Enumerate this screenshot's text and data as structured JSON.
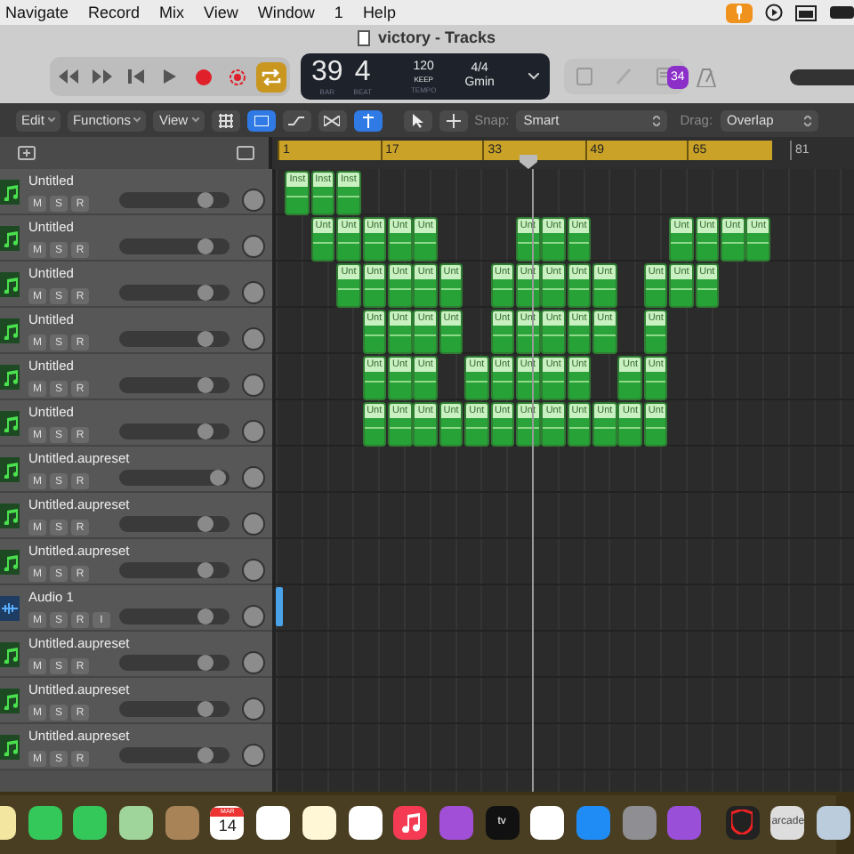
{
  "menu_bar": {
    "items": [
      "Navigate",
      "Record",
      "Mix",
      "View",
      "Window",
      "1",
      "Help"
    ]
  },
  "window": {
    "title": "victory - Tracks"
  },
  "transport": [
    {
      "kind": "rewind"
    },
    {
      "kind": "forward"
    },
    {
      "kind": "to-start"
    },
    {
      "kind": "play"
    },
    {
      "kind": "record"
    },
    {
      "kind": "capture"
    },
    {
      "kind": "cycle",
      "on": true
    }
  ],
  "lcd": {
    "bar": "39",
    "beat": "4",
    "bar_label": "BAR",
    "beat_label": "BEAT",
    "tempo": "120",
    "tempo_mode": "KEEP",
    "tempo_label": "TEMPO",
    "signature": "4/4",
    "key": "Gmin"
  },
  "badge": "34",
  "toolbar": {
    "menus": [
      "Edit",
      "Functions",
      "View"
    ],
    "snap_label": "Snap:",
    "snap_value": "Smart",
    "drag_label": "Drag:",
    "drag_value": "Overlap"
  },
  "ruler": {
    "markers": [
      "1",
      "17",
      "33",
      "49",
      "65",
      "81"
    ]
  },
  "tracks": [
    {
      "name": "Untitled",
      "kind": "instrument",
      "buttons": [
        "M",
        "S",
        "R"
      ],
      "level": 0.78,
      "lane": [
        {
          "kind": "region",
          "label": "Inst"
        },
        {
          "kind": "region",
          "label": "Inst"
        },
        {
          "kind": "region",
          "label": "Inst"
        }
      ]
    },
    {
      "name": "Untitled",
      "kind": "instrument",
      "buttons": [
        "M",
        "S",
        "R"
      ],
      "level": 0.78,
      "lane": [
        {
          "kind": "empty"
        },
        {
          "kind": "region",
          "label": "Unt"
        },
        {
          "kind": "region",
          "label": "Unt"
        },
        {
          "kind": "region",
          "label": "Unt"
        },
        {
          "kind": "region",
          "label": "Unt"
        },
        {
          "kind": "region",
          "label": "Unt"
        },
        {
          "kind": "empty"
        },
        {
          "kind": "empty"
        },
        {
          "kind": "empty"
        },
        {
          "kind": "region",
          "label": "Unt"
        },
        {
          "kind": "region",
          "label": "Unt"
        },
        {
          "kind": "region",
          "label": "Unt"
        },
        {
          "kind": "empty"
        },
        {
          "kind": "empty"
        },
        {
          "kind": "empty"
        },
        {
          "kind": "region",
          "label": "Unt"
        },
        {
          "kind": "region",
          "label": "Unt"
        },
        {
          "kind": "region",
          "label": "Unt"
        },
        {
          "kind": "region",
          "label": "Unt"
        }
      ]
    },
    {
      "name": "Untitled",
      "kind": "instrument",
      "buttons": [
        "M",
        "S",
        "R"
      ],
      "level": 0.78,
      "lane": [
        {
          "kind": "empty"
        },
        {
          "kind": "empty"
        },
        {
          "kind": "region",
          "label": "Unt"
        },
        {
          "kind": "region",
          "label": "Unt"
        },
        {
          "kind": "region",
          "label": "Unt"
        },
        {
          "kind": "region",
          "label": "Unt"
        },
        {
          "kind": "region",
          "label": "Unt"
        },
        {
          "kind": "empty"
        },
        {
          "kind": "region",
          "label": "Unt"
        },
        {
          "kind": "region",
          "label": "Unt"
        },
        {
          "kind": "region",
          "label": "Unt"
        },
        {
          "kind": "region",
          "label": "Unt"
        },
        {
          "kind": "region",
          "label": "Unt"
        },
        {
          "kind": "empty"
        },
        {
          "kind": "region",
          "label": "Unt"
        },
        {
          "kind": "region",
          "label": "Unt"
        },
        {
          "kind": "region",
          "label": "Unt"
        }
      ]
    },
    {
      "name": "Untitled",
      "kind": "instrument",
      "buttons": [
        "M",
        "S",
        "R"
      ],
      "level": 0.78,
      "lane": [
        {
          "kind": "empty"
        },
        {
          "kind": "empty"
        },
        {
          "kind": "empty"
        },
        {
          "kind": "region",
          "label": "Unt"
        },
        {
          "kind": "region",
          "label": "Unt"
        },
        {
          "kind": "region",
          "label": "Unt"
        },
        {
          "kind": "region",
          "label": "Unt"
        },
        {
          "kind": "empty"
        },
        {
          "kind": "region",
          "label": "Unt"
        },
        {
          "kind": "region",
          "label": "Unt"
        },
        {
          "kind": "region",
          "label": "Unt"
        },
        {
          "kind": "region",
          "label": "Unt"
        },
        {
          "kind": "region",
          "label": "Unt"
        },
        {
          "kind": "empty"
        },
        {
          "kind": "region",
          "label": "Unt"
        }
      ]
    },
    {
      "name": "Untitled",
      "kind": "instrument",
      "buttons": [
        "M",
        "S",
        "R"
      ],
      "level": 0.78,
      "lane": [
        {
          "kind": "empty"
        },
        {
          "kind": "empty"
        },
        {
          "kind": "empty"
        },
        {
          "kind": "region",
          "label": "Unt"
        },
        {
          "kind": "region",
          "label": "Unt"
        },
        {
          "kind": "region",
          "label": "Unt"
        },
        {
          "kind": "empty"
        },
        {
          "kind": "region",
          "label": "Unt"
        },
        {
          "kind": "region",
          "label": "Unt"
        },
        {
          "kind": "region",
          "label": "Unt"
        },
        {
          "kind": "region",
          "label": "Unt"
        },
        {
          "kind": "region",
          "label": "Unt"
        },
        {
          "kind": "empty"
        },
        {
          "kind": "region",
          "label": "Unt"
        },
        {
          "kind": "region",
          "label": "Unt"
        }
      ]
    },
    {
      "name": "Untitled",
      "kind": "instrument",
      "buttons": [
        "M",
        "S",
        "R"
      ],
      "level": 0.78,
      "lane": [
        {
          "kind": "empty"
        },
        {
          "kind": "empty"
        },
        {
          "kind": "empty"
        },
        {
          "kind": "region",
          "label": "Unt"
        },
        {
          "kind": "region",
          "label": "Unt"
        },
        {
          "kind": "region",
          "label": "Unt"
        },
        {
          "kind": "region",
          "label": "Unt"
        },
        {
          "kind": "region",
          "label": "Unt"
        },
        {
          "kind": "region",
          "label": "Unt"
        },
        {
          "kind": "region",
          "label": "Unt"
        },
        {
          "kind": "region",
          "label": "Unt"
        },
        {
          "kind": "region",
          "label": "Unt"
        },
        {
          "kind": "region",
          "label": "Unt"
        },
        {
          "kind": "region",
          "label": "Unt"
        },
        {
          "kind": "region",
          "label": "Unt"
        }
      ]
    },
    {
      "name": "Untitled.aupreset",
      "kind": "instrument",
      "buttons": [
        "M",
        "S",
        "R"
      ],
      "level": 0.9
    },
    {
      "name": "Untitled.aupreset",
      "kind": "instrument",
      "buttons": [
        "M",
        "S",
        "R"
      ],
      "level": 0.78
    },
    {
      "name": "Untitled.aupreset",
      "kind": "instrument",
      "buttons": [
        "M",
        "S",
        "R"
      ],
      "level": 0.78
    },
    {
      "name": "Audio 1",
      "kind": "audio",
      "buttons": [
        "M",
        "S",
        "R",
        "I"
      ],
      "level": 0.78,
      "lane": [
        {
          "kind": "audio"
        }
      ]
    },
    {
      "name": "Untitled.aupreset",
      "kind": "instrument",
      "buttons": [
        "M",
        "S",
        "R"
      ],
      "level": 0.78
    },
    {
      "name": "Untitled.aupreset",
      "kind": "instrument",
      "buttons": [
        "M",
        "S",
        "R"
      ],
      "level": 0.78
    },
    {
      "name": "Untitled.aupreset",
      "kind": "instrument",
      "buttons": [
        "M",
        "S",
        "R"
      ],
      "level": 0.78
    }
  ],
  "dock": [
    {
      "kind": "photos"
    },
    {
      "kind": "facetime"
    },
    {
      "kind": "messages"
    },
    {
      "kind": "maps"
    },
    {
      "kind": "contacts"
    },
    {
      "kind": "calendar",
      "month": "MAR",
      "day": "14"
    },
    {
      "kind": "reminders"
    },
    {
      "kind": "notes"
    },
    {
      "kind": "freeform"
    },
    {
      "kind": "music"
    },
    {
      "kind": "podcasts"
    },
    {
      "kind": "tv",
      "label": "tv"
    },
    {
      "kind": "news"
    },
    {
      "kind": "appstore"
    },
    {
      "kind": "settings"
    },
    {
      "kind": "feedback"
    },
    {
      "kind": "divider"
    },
    {
      "kind": "shield"
    },
    {
      "kind": "arcade",
      "label": "arcade"
    },
    {
      "kind": "quicktime"
    }
  ]
}
